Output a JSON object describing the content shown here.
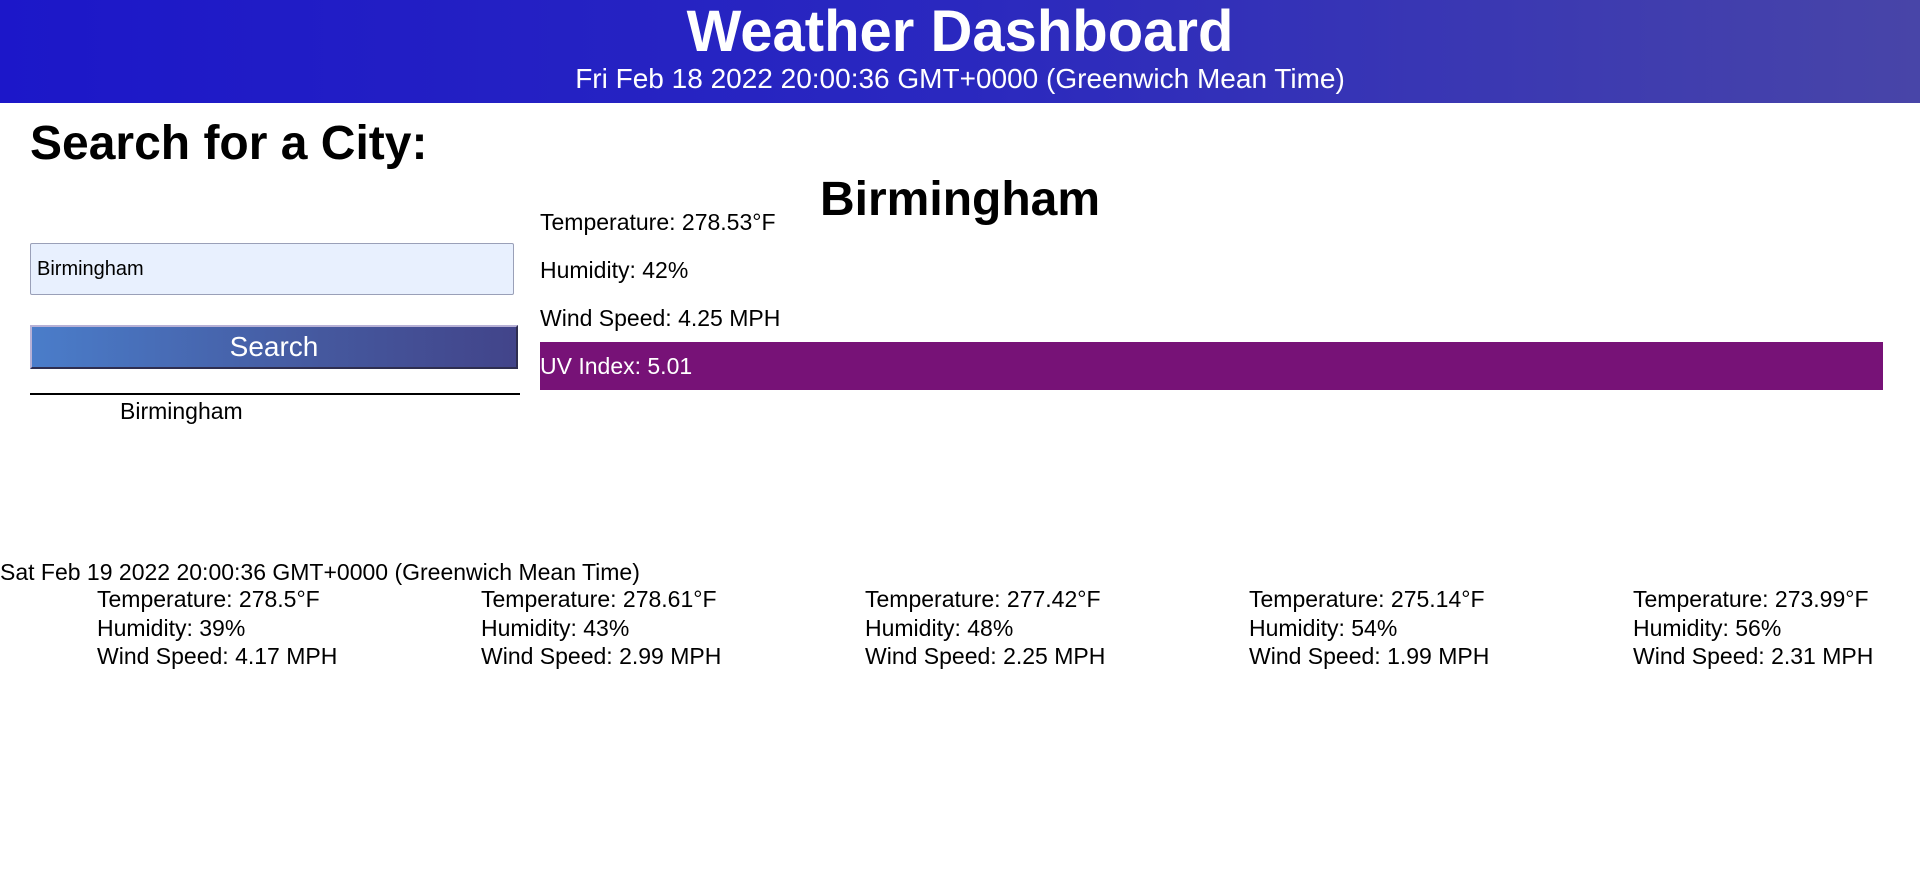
{
  "header": {
    "title": "Weather Dashboard",
    "date": "Fri Feb 18 2022 20:00:36 GMT+0000 (Greenwich Mean Time)"
  },
  "search": {
    "heading": "Search for a City:",
    "input_value": "Birmingham",
    "button_label": "Search",
    "history": [
      "Birmingham"
    ]
  },
  "current": {
    "city": "Birmingham",
    "temperature": "Temperature: 278.53°F",
    "humidity": "Humidity: 42%",
    "wind": "Wind Speed: 4.25 MPH",
    "uv": "UV Index: 5.01",
    "uv_color": "#771277"
  },
  "forecast": {
    "date": "Sat Feb 19 2022 20:00:36 GMT+0000 (Greenwich Mean Time)",
    "days": [
      {
        "temperature": "Temperature: 278.5°F",
        "humidity": "Humidity: 39%",
        "wind": "Wind Speed: 4.17 MPH"
      },
      {
        "temperature": "Temperature: 278.61°F",
        "humidity": "Humidity: 43%",
        "wind": "Wind Speed: 2.99 MPH"
      },
      {
        "temperature": "Temperature: 277.42°F",
        "humidity": "Humidity: 48%",
        "wind": "Wind Speed: 2.25 MPH"
      },
      {
        "temperature": "Temperature: 275.14°F",
        "humidity": "Humidity: 54%",
        "wind": "Wind Speed: 1.99 MPH"
      },
      {
        "temperature": "Temperature: 273.99°F",
        "humidity": "Humidity: 56%",
        "wind": "Wind Speed: 2.31 MPH"
      }
    ]
  }
}
